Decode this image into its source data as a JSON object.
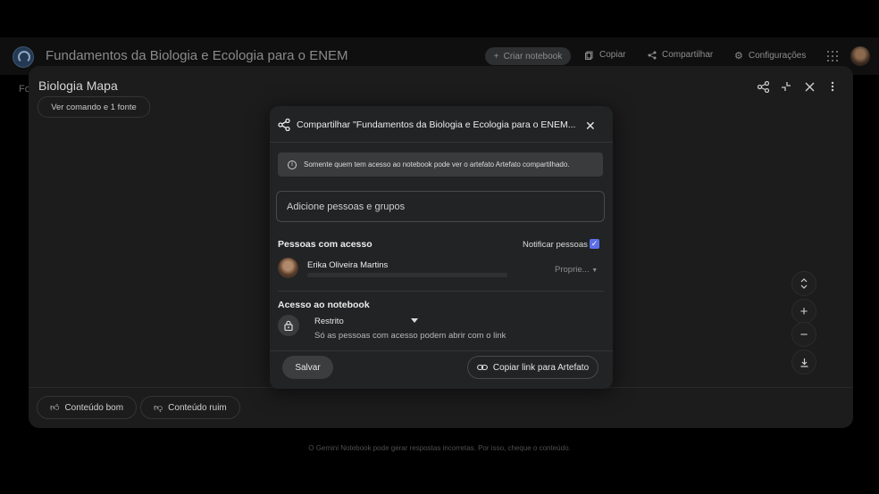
{
  "app": {
    "notebook_title": "Fundamentos da Biologia e Ecologia para o ENEM",
    "create_notebook": "Criar notebook",
    "copy": "Copiar",
    "share": "Compartilhar",
    "settings": "Configurações",
    "left_fragment": "Fo"
  },
  "panel": {
    "title": "Biologia Mapa",
    "command_chip": "Ver comando e 1 fonte",
    "good_content": "Conteúdo bom",
    "bad_content": "Conteúdo ruim"
  },
  "footer": "O Gemini Notebook pode gerar respostas incorretas. Por isso, cheque o conteúdo.",
  "dialog": {
    "title": "Compartilhar \"Fundamentos da Biologia e Ecologia para o ENEM...",
    "info": "Somente quem tem acesso ao notebook pode ver o artefato Artefato compartilhado.",
    "add_placeholder": "Adicione pessoas e grupos",
    "people_heading": "Pessoas com acesso",
    "notify_label": "Notificar pessoas",
    "notify_checked": true,
    "person": {
      "name": "Erika Oliveira Martins",
      "role": "Proprie..."
    },
    "access_heading": "Acesso ao notebook",
    "access_value": "Restrito",
    "access_desc": "Só as pessoas com acesso podem abrir com o link",
    "save": "Salvar",
    "copy_link": "Copiar link para Artefato"
  },
  "colors": {
    "accent": "#5b6fe8",
    "dialog_bg": "#222324",
    "panel_bg": "#1c1c1d"
  }
}
